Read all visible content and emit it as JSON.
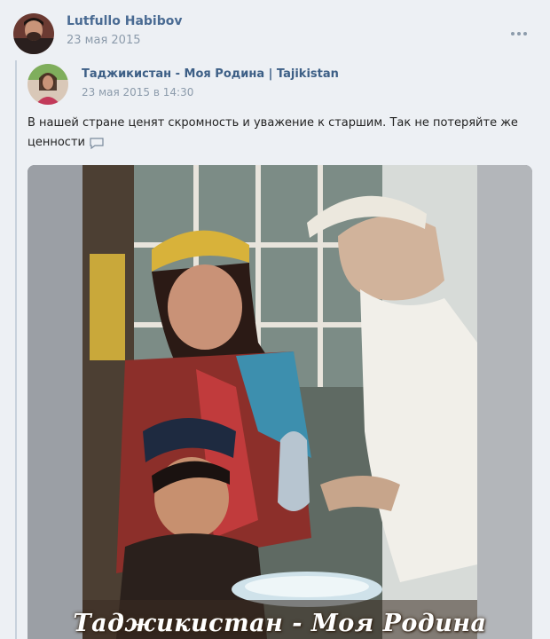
{
  "post": {
    "author": {
      "name": "Lutfullo Habibov",
      "date": "23 мая 2015",
      "avatar_icon": "user-avatar"
    },
    "more_icon": "more-dots-icon",
    "repost": {
      "group_name": "Таджикистан - Моя Родина | Tajikistan",
      "date": "23 мая 2015 в 14:30",
      "avatar_icon": "group-avatar"
    },
    "text": "В нашей стране ценят скромность и уважение к старшим. Так не потеряйте же ценности",
    "text_icon": "speech-bubble-icon",
    "photo": {
      "caption": "Таджикистан - Моя Родина"
    }
  },
  "colors": {
    "background": "#edf0f4",
    "link": "#4a6b93",
    "meta": "#8c9bab"
  }
}
